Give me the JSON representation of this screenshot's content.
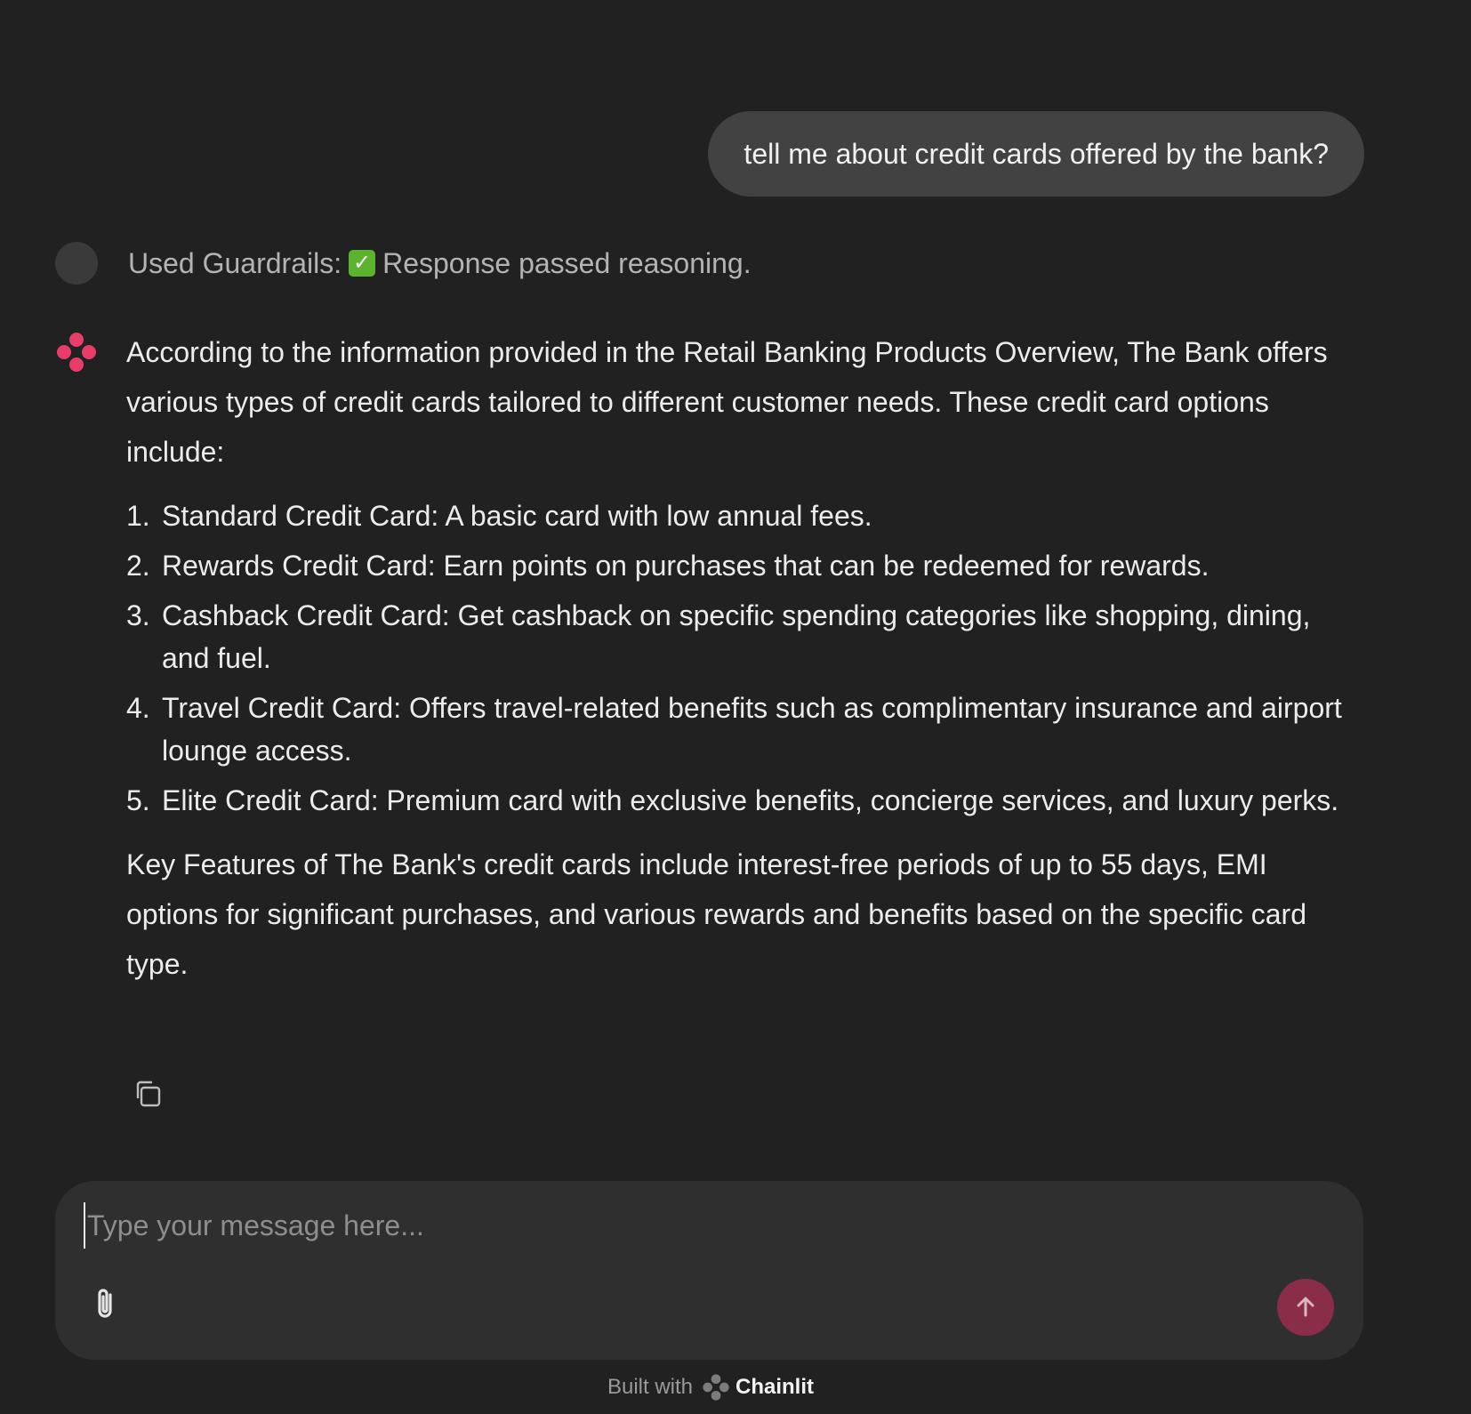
{
  "user_message": "tell me about credit cards offered by the bank?",
  "step": {
    "prefix": "Used Guardrails:",
    "check_icon": "check-mark-button-icon",
    "suffix": "Response passed reasoning."
  },
  "assistant": {
    "intro": "According to the information provided in the Retail Banking Products Overview, The Bank offers various types of credit cards tailored to different customer needs. These credit card options include:",
    "items": [
      {
        "num": "1.",
        "text": "Standard Credit Card: A basic card with low annual fees."
      },
      {
        "num": "2.",
        "text": "Rewards Credit Card: Earn points on purchases that can be redeemed for rewards."
      },
      {
        "num": "3.",
        "text": "Cashback Credit Card: Get cashback on specific spending categories like shopping, dining, and fuel."
      },
      {
        "num": "4.",
        "text": "Travel Credit Card: Offers travel-related benefits such as complimentary insurance and airport lounge access."
      },
      {
        "num": "5.",
        "text": "Elite Credit Card: Premium card with exclusive benefits, concierge services, and luxury perks."
      }
    ],
    "outro": "Key Features of The Bank's credit cards include interest-free periods of up to 55 days, EMI options for significant purchases, and various rewards and benefits based on the specific card type."
  },
  "composer": {
    "placeholder": "Type your message here...",
    "value": ""
  },
  "footer": {
    "built_with": "Built with",
    "brand": "Chainlit"
  },
  "colors": {
    "background": "#212121",
    "user_bubble": "#424242",
    "composer": "#2f2f2f",
    "accent": "#e83d68",
    "send_button": "#8a2d48"
  }
}
